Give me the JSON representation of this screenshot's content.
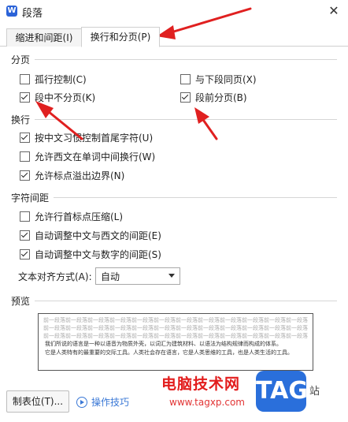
{
  "window": {
    "app_logo": "W",
    "title": "段落",
    "close_glyph": "✕"
  },
  "tabs": [
    {
      "label": "缩进和间距(I)"
    },
    {
      "label": "换行和分页(P)"
    }
  ],
  "sections": {
    "pagination": {
      "title": "分页",
      "items": [
        {
          "label": "孤行控制(C)",
          "checked": false
        },
        {
          "label": "与下段同页(X)",
          "checked": false
        },
        {
          "label": "段中不分页(K)",
          "checked": true
        },
        {
          "label": "段前分页(B)",
          "checked": true
        }
      ]
    },
    "line_break": {
      "title": "换行",
      "items": [
        {
          "label": "按中文习惯控制首尾字符(U)",
          "checked": true
        },
        {
          "label": "允许西文在单词中间换行(W)",
          "checked": false
        },
        {
          "label": "允许标点溢出边界(N)",
          "checked": true
        }
      ]
    },
    "char_spacing": {
      "title": "字符间距",
      "items": [
        {
          "label": "允许行首标点压缩(L)",
          "checked": false
        },
        {
          "label": "自动调整中文与西文的间距(E)",
          "checked": true
        },
        {
          "label": "自动调整中文与数字的间距(S)",
          "checked": true
        }
      ],
      "text_align": {
        "label": "文本对齐方式(A):",
        "value": "自动"
      }
    },
    "preview": {
      "title": "预览",
      "gray_line": "前一段落前一段落前一段落前一段落前一段落前一段落前一段落前一段落前一段落前一段落前一段落前一段落",
      "text_line1": "我们所说的语言是一种以语音为物质外壳，以词汇为建筑材料、以语法为结构规律而构成的体系。",
      "text_line2": "它是人类特有的最重要的交际工具。人类社会存在语言，它是人类思维的工具，也是人类生活的工具。"
    }
  },
  "footer": {
    "tabstops_button": "制表位(T)...",
    "tips_link": "操作技巧"
  },
  "watermark": {
    "title": "电脑技术网",
    "url": "www.tagxp.com",
    "badge": "TAG",
    "side": "站"
  },
  "colors": {
    "accent_blue": "#3a78d6",
    "arrow_red": "#e02020",
    "checkbox_border": "#666666"
  }
}
